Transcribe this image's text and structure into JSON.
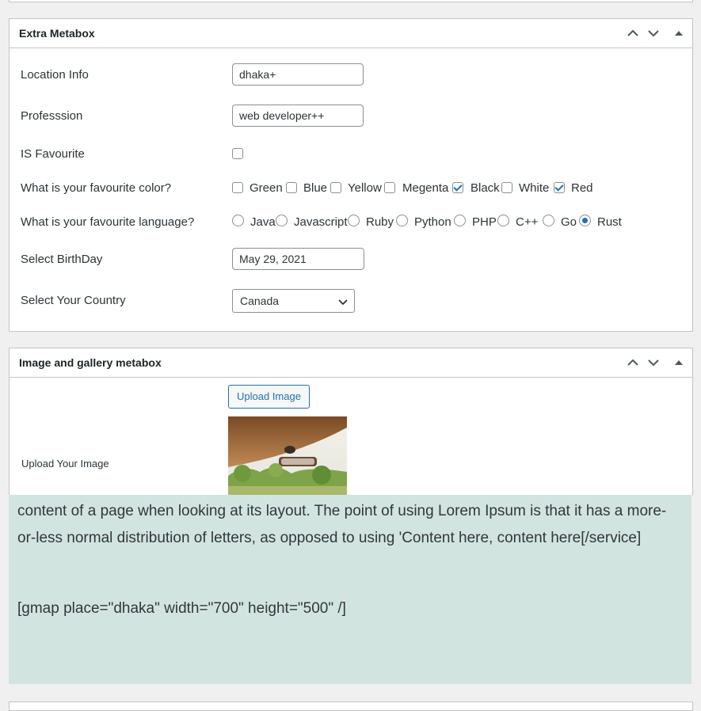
{
  "extra_metabox": {
    "title": "Extra Metabox",
    "fields": {
      "location": {
        "label": "Location Info",
        "value": "dhaka+"
      },
      "profession": {
        "label": "Professsion",
        "value": "web developer++"
      },
      "favourite": {
        "label": "IS Favourite",
        "checked": false
      },
      "color": {
        "label": "What is your favourite color?",
        "options": [
          {
            "label": "Green",
            "checked": false
          },
          {
            "label": "Blue",
            "checked": false
          },
          {
            "label": "Yellow",
            "checked": false
          },
          {
            "label": "Megenta",
            "checked": false
          },
          {
            "label": "Black",
            "checked": true
          },
          {
            "label": "White",
            "checked": false
          },
          {
            "label": "Red",
            "checked": true
          }
        ]
      },
      "language": {
        "label": "What is your favourite language?",
        "options": [
          "Java",
          "Javascript",
          "Ruby",
          "Python",
          "PHP",
          "C++",
          "Go",
          "Rust"
        ],
        "selected": "Rust"
      },
      "birthday": {
        "label": "Select BirthDay",
        "value": "May 29, 2021"
      },
      "country": {
        "label": "Select Your Country",
        "value": "Canada"
      }
    }
  },
  "image_metabox": {
    "title": "Image and gallery metabox",
    "upload_label": "Upload Your Image",
    "upload_button": "Upload Image"
  },
  "content": {
    "paragraph": "content of a page when looking at its layout. The point of using Lorem Ipsum is that it has a more-or-less normal distribution of letters, as opposed to using 'Content here, content here[/service]",
    "shortcode": "[gmap place=\"dhaka\" width=\"700\" height=\"500\" /]"
  },
  "colors": {
    "accent": "#2271b1",
    "content_bg": "#d2e4df",
    "border": "#c3c4c7"
  }
}
